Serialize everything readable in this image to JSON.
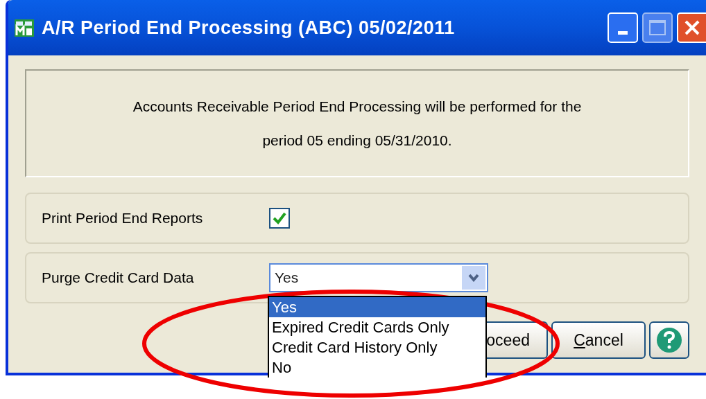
{
  "window": {
    "title": "A/R Period End Processing (ABC) 05/02/2011"
  },
  "message": [
    "Accounts Receivable Period End Processing will be performed for the",
    "period 05 ending 05/31/2010."
  ],
  "options": [
    {
      "kind": "checkbox",
      "label": "Print Period End Reports",
      "checked": true
    },
    {
      "kind": "dropdown",
      "label": "Purge Credit Card Data",
      "value": "Yes",
      "expanded": true,
      "items": [
        {
          "label": "Yes",
          "selected": true
        },
        {
          "label": "Expired Credit Cards Only",
          "selected": false
        },
        {
          "label": "Credit Card History Only",
          "selected": false
        },
        {
          "label": "No",
          "selected": false
        }
      ]
    }
  ],
  "buttons": [
    {
      "kind": "text",
      "label": "oceed",
      "mnemonic": false
    },
    {
      "kind": "text",
      "label": "Cancel",
      "mnemonic": true
    },
    {
      "kind": "help"
    }
  ]
}
